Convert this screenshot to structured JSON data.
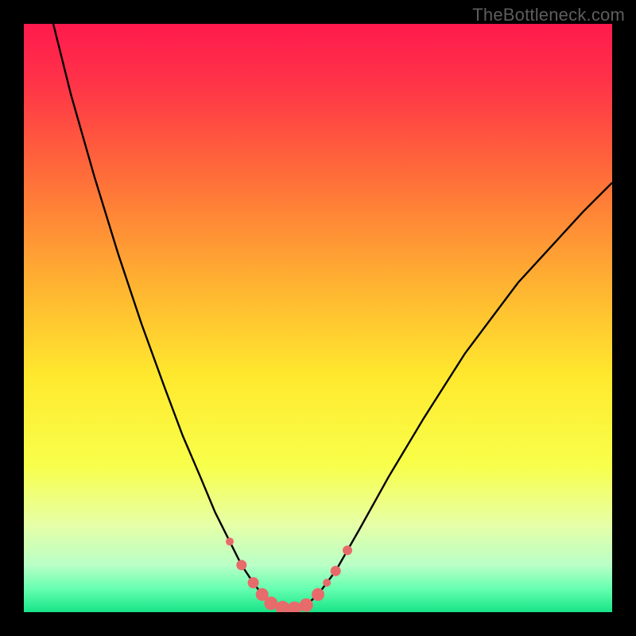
{
  "watermark": "TheBottleneck.com",
  "gradient": {
    "stops": [
      {
        "offset": 0.0,
        "color": "#ff1a4d"
      },
      {
        "offset": 0.1,
        "color": "#ff3348"
      },
      {
        "offset": 0.25,
        "color": "#ff6a3a"
      },
      {
        "offset": 0.45,
        "color": "#ffb531"
      },
      {
        "offset": 0.6,
        "color": "#ffe92e"
      },
      {
        "offset": 0.75,
        "color": "#f8ff4a"
      },
      {
        "offset": 0.85,
        "color": "#e7ffa6"
      },
      {
        "offset": 0.92,
        "color": "#b9ffc6"
      },
      {
        "offset": 0.96,
        "color": "#66ffb0"
      },
      {
        "offset": 1.0,
        "color": "#17e487"
      }
    ]
  },
  "chart_data": {
    "type": "line",
    "title": "",
    "xlabel": "",
    "ylabel": "",
    "x_range": [
      0,
      100
    ],
    "y_range": [
      0,
      100
    ],
    "ylim": [
      0,
      100
    ],
    "xlim": [
      0,
      100
    ],
    "series": [
      {
        "name": "curve",
        "stroke": "#000000",
        "x": [
          5,
          8,
          12,
          16,
          20,
          24,
          27,
          30,
          32.5,
          35,
          37,
          39,
          40.5,
          42,
          44,
          46,
          48,
          50,
          53,
          57,
          62,
          68,
          75,
          84,
          95,
          100
        ],
        "y": [
          100,
          88,
          74,
          61,
          49,
          38,
          30,
          23,
          17,
          12,
          8,
          5,
          3,
          1.5,
          0.7,
          0.6,
          1.2,
          3,
          7,
          14,
          23,
          33,
          44,
          56,
          68,
          73
        ]
      }
    ],
    "markers": {
      "name": "dip-points",
      "color": "#e76b6b",
      "x": [
        35,
        37,
        39,
        40.5,
        42,
        44,
        46,
        48,
        50,
        51.5,
        53,
        55
      ],
      "y": [
        12,
        8,
        5,
        3,
        1.5,
        0.7,
        0.6,
        1.2,
        3,
        5,
        7,
        10.5
      ],
      "r": [
        5,
        6.5,
        7,
        8,
        8.5,
        9,
        9,
        8.5,
        8,
        5,
        6.5,
        6
      ]
    }
  }
}
